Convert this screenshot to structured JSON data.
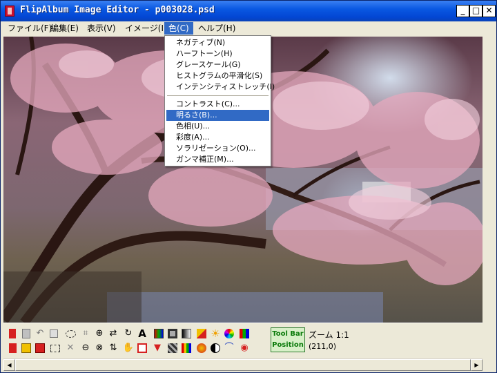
{
  "window": {
    "title": "FlipAlbum Image Editor - p003028.psd"
  },
  "titlebar": {
    "min": "_",
    "max": "□",
    "close": "✕"
  },
  "menubar": [
    {
      "label": "ファイル(F)"
    },
    {
      "label": "編集(E)"
    },
    {
      "label": "表示(V)"
    },
    {
      "label": "イメージ(I)"
    },
    {
      "label": "色(C)",
      "active": true
    },
    {
      "label": "ヘルプ(H)"
    }
  ],
  "color_menu": {
    "items": [
      {
        "label": "ネガティブ(N)"
      },
      {
        "label": "ハーフトーン(H)"
      },
      {
        "label": "グレースケール(G)"
      },
      {
        "label": "ヒストグラムの平滑化(S)"
      },
      {
        "label": "インテンシティストレッチ(I)"
      },
      {
        "label": "コントラスト(C)..."
      },
      {
        "label": "明るさ(B)...",
        "highlighted": true
      },
      {
        "label": "色相(U)..."
      },
      {
        "label": "彩度(A)..."
      },
      {
        "label": "ソラリゼーション(O)..."
      },
      {
        "label": "ガンマ補正(M)..."
      }
    ]
  },
  "toolbar": {
    "position_button": {
      "line1": "Tool Bar",
      "line2": "Position"
    },
    "zoom": "ズーム 1:1",
    "coords": "(211,0)",
    "row1": [
      "bookmark-red-icon",
      "copy-doc-icon",
      "undo-icon",
      "duplicate-icon",
      "ellipse-select-icon",
      "crop-icon",
      "zoom-in-icon",
      "swap-arrows-icon",
      "rotate-icon",
      "text-icon",
      "gradient-icon",
      "frame-icon",
      "grayscale-icon",
      "arrow-star-icon",
      "sun-icon",
      "color-wheel-icon",
      "color-bars-icon"
    ],
    "row2": [
      "new-doc-icon",
      "open-folder-icon",
      "paste-icon",
      "rect-select-icon",
      "cross-select-icon",
      "zoom-out-icon",
      "zoom-fit-icon",
      "flip-icon",
      "hand-icon",
      "border-icon",
      "funnel-icon",
      "mosaic-icon",
      "buildings-icon",
      "burst-icon",
      "halfcircle-icon",
      "curve-icon",
      "eye-icon"
    ],
    "colors": {
      "red": "#D62020",
      "blue": "#2040C0",
      "yellow": "#F0C000",
      "green": "#1E8A1E"
    }
  },
  "scrollbar": {
    "left_arrow": "◀",
    "right_arrow": "▶"
  }
}
